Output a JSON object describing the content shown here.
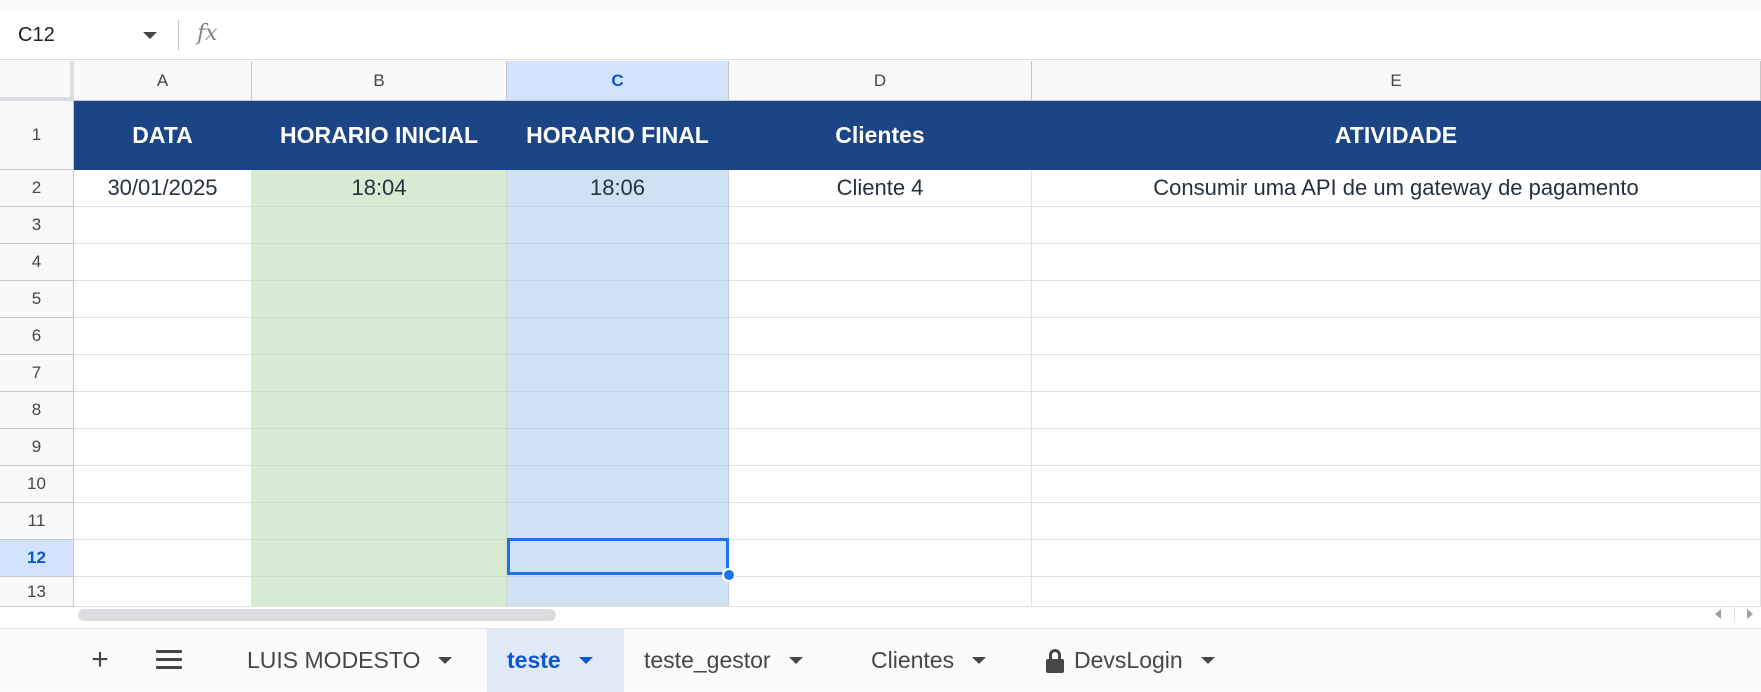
{
  "formula_bar": {
    "name_box": "C12",
    "fx_label": "fx",
    "formula_value": ""
  },
  "columns": [
    "A",
    "B",
    "C",
    "D",
    "E"
  ],
  "selected_column": "C",
  "rows": [
    "1",
    "2",
    "3",
    "4",
    "5",
    "6",
    "7",
    "8",
    "9",
    "10",
    "11",
    "12",
    "13"
  ],
  "selected_row": "12",
  "header_row": [
    "DATA",
    "HORARIO INICIAL",
    "HORARIO FINAL",
    "Clientes",
    "ATIVIDADE"
  ],
  "data_rows": [
    [
      "30/01/2025",
      "18:04",
      "18:06",
      "Cliente 4",
      "Consumir uma API de um gateway de pagamento"
    ]
  ],
  "colors": {
    "header_bg": "#1c4587",
    "col_b_fill": "#d9ead3",
    "col_c_fill": "#cfe2f3",
    "selection": "#1a73e8"
  },
  "sheet_tabs": {
    "add_label": "+",
    "tabs": [
      {
        "label": "LUIS MODESTO",
        "active": false,
        "locked": false
      },
      {
        "label": "teste",
        "active": true,
        "locked": false
      },
      {
        "label": "teste_gestor",
        "active": false,
        "locked": false
      },
      {
        "label": "Clientes",
        "active": false,
        "locked": false
      },
      {
        "label": "DevsLogin",
        "active": false,
        "locked": true
      }
    ]
  },
  "icons": {
    "name_box_dropdown": "chevron-down-icon",
    "formula": "fx-icon",
    "all_sheets": "menu-icon",
    "protected_sheet": "lock-icon"
  }
}
